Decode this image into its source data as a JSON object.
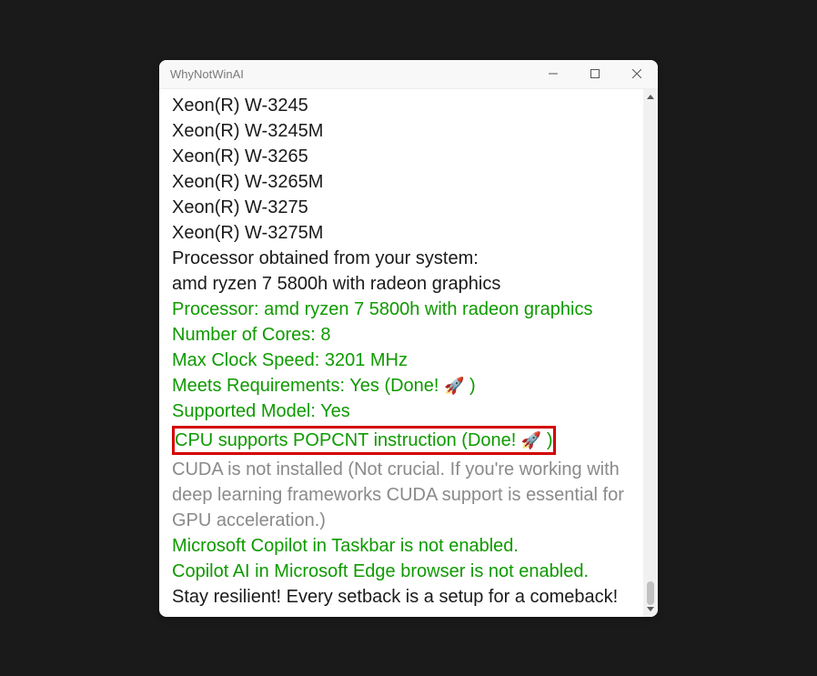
{
  "window": {
    "title": "WhyNotWinAI"
  },
  "lines": {
    "cpu0": "Xeon(R) W-3245",
    "cpu1": "Xeon(R) W-3245M",
    "cpu2": "Xeon(R) W-3265",
    "cpu3": "Xeon(R) W-3265M",
    "cpu4": "Xeon(R) W-3275",
    "cpu5": "Xeon(R) W-3275M",
    "obtained": "Processor obtained from your system:",
    "proc_name": "amd ryzen 7 5800h with radeon graphics",
    "proc_detail": "Processor: amd ryzen 7 5800h with radeon graphics",
    "cores": "Number of Cores: 8",
    "clock": "Max Clock Speed: 3201 MHz",
    "meets_pre": "Meets Requirements: Yes (Done! ",
    "meets_post": " )",
    "supported": "Supported Model: Yes",
    "popcnt_pre": "CPU supports POPCNT instruction (Done! ",
    "popcnt_post": " )",
    "cuda": "CUDA is not installed (Not crucial. If you're working with deep learning frameworks CUDA support is essential for GPU acceleration.)",
    "copilot_taskbar": "Microsoft Copilot in Taskbar is not enabled.",
    "copilot_edge": "Copilot AI in Microsoft Edge browser is not enabled.",
    "motivation": "Stay resilient! Every setback is a setup for a comeback!"
  },
  "icons": {
    "rocket": "🚀"
  }
}
